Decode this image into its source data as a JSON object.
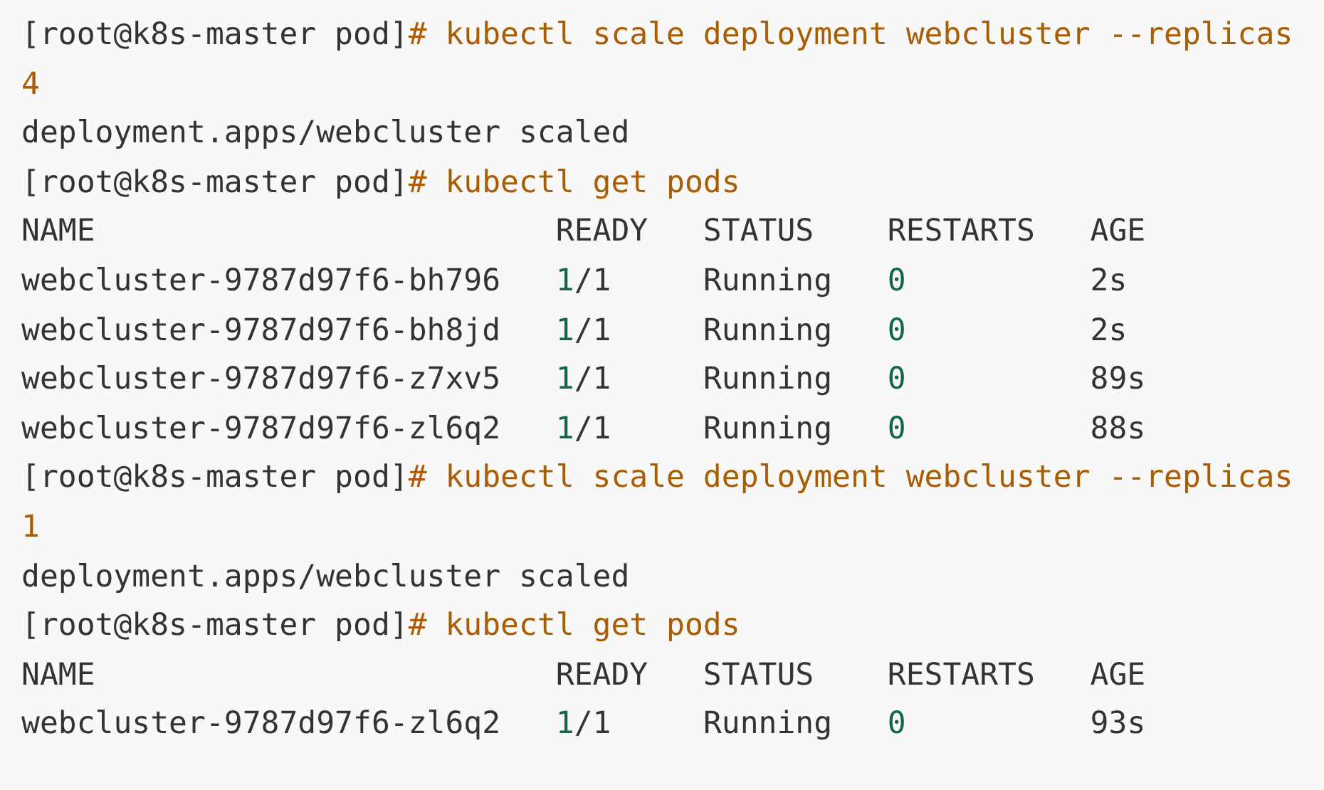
{
  "code_block": {
    "lines": [
      [
        {
          "kind": "plain",
          "text": "[root@k8s-master pod]"
        },
        {
          "kind": "command",
          "text": "# kubectl scale deployment webcluster --replicas"
        }
      ],
      [
        {
          "kind": "command",
          "text": "4"
        }
      ],
      [
        {
          "kind": "plain",
          "text": "deployment.apps/webcluster scaled"
        }
      ],
      [
        {
          "kind": "plain",
          "text": "[root@k8s-master pod]"
        },
        {
          "kind": "command",
          "text": "# kubectl get pods"
        }
      ],
      [
        {
          "kind": "plain",
          "text": "NAME                         READY   STATUS    RESTARTS   AGE"
        }
      ],
      [
        {
          "kind": "plain",
          "text": "webcluster-9787d97f6-bh796   "
        },
        {
          "kind": "number",
          "text": "1"
        },
        {
          "kind": "plain",
          "text": "/1     Running   "
        },
        {
          "kind": "number",
          "text": "0"
        },
        {
          "kind": "plain",
          "text": "          2s"
        }
      ],
      [
        {
          "kind": "plain",
          "text": "webcluster-9787d97f6-bh8jd   "
        },
        {
          "kind": "number",
          "text": "1"
        },
        {
          "kind": "plain",
          "text": "/1     Running   "
        },
        {
          "kind": "number",
          "text": "0"
        },
        {
          "kind": "plain",
          "text": "          2s"
        }
      ],
      [
        {
          "kind": "plain",
          "text": "webcluster-9787d97f6-z7xv5   "
        },
        {
          "kind": "number",
          "text": "1"
        },
        {
          "kind": "plain",
          "text": "/1     Running   "
        },
        {
          "kind": "number",
          "text": "0"
        },
        {
          "kind": "plain",
          "text": "          89s"
        }
      ],
      [
        {
          "kind": "plain",
          "text": "webcluster-9787d97f6-zl6q2   "
        },
        {
          "kind": "number",
          "text": "1"
        },
        {
          "kind": "plain",
          "text": "/1     Running   "
        },
        {
          "kind": "number",
          "text": "0"
        },
        {
          "kind": "plain",
          "text": "          88s"
        }
      ],
      [
        {
          "kind": "plain",
          "text": "[root@k8s-master pod]"
        },
        {
          "kind": "command",
          "text": "# kubectl scale deployment webcluster --replicas"
        }
      ],
      [
        {
          "kind": "command",
          "text": "1"
        }
      ],
      [
        {
          "kind": "plain",
          "text": "deployment.apps/webcluster scaled"
        }
      ],
      [
        {
          "kind": "plain",
          "text": "[root@k8s-master pod]"
        },
        {
          "kind": "command",
          "text": "# kubectl get pods"
        }
      ],
      [
        {
          "kind": "plain",
          "text": "NAME                         READY   STATUS    RESTARTS   AGE"
        }
      ],
      [
        {
          "kind": "plain",
          "text": "webcluster-9787d97f6-zl6q2   "
        },
        {
          "kind": "number",
          "text": "1"
        },
        {
          "kind": "plain",
          "text": "/1     Running   "
        },
        {
          "kind": "number",
          "text": "0"
        },
        {
          "kind": "plain",
          "text": "          93s"
        }
      ]
    ]
  }
}
